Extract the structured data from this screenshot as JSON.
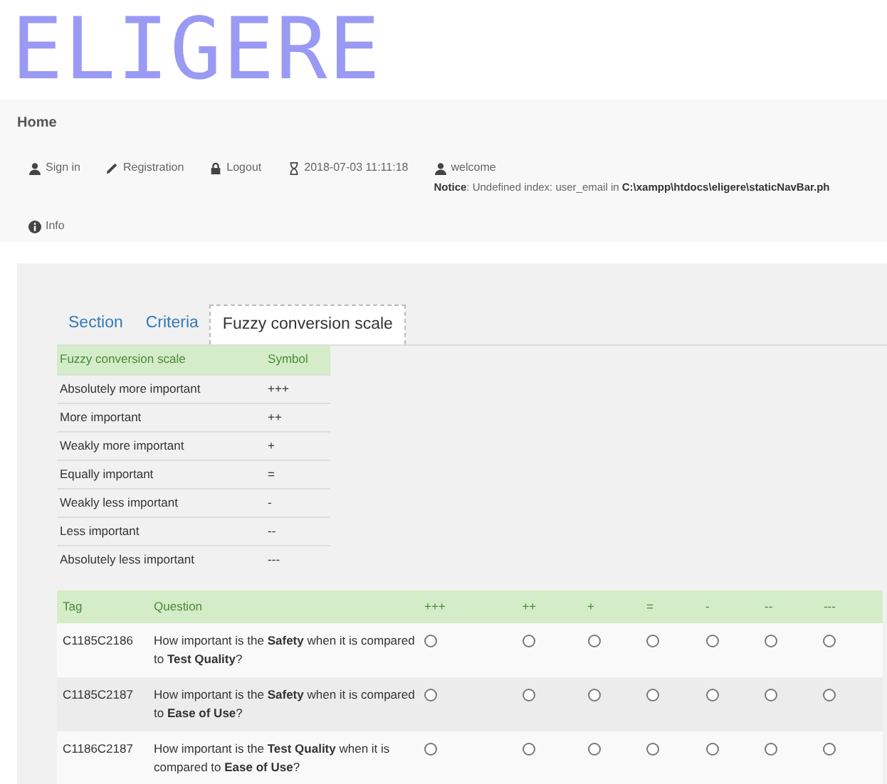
{
  "logo": "ELIGERE",
  "page_title": "Home",
  "nav": [
    {
      "kind": "user",
      "label": "Sign in"
    },
    {
      "kind": "pencil",
      "label": "Registration"
    },
    {
      "kind": "lock",
      "label": "Logout"
    },
    {
      "kind": "hourglass",
      "label": "2018-07-03 11:11:18"
    },
    {
      "kind": "user",
      "label": "welcome"
    }
  ],
  "notice": {
    "label": "Notice",
    "text": ": Undefined index: user_email in ",
    "path": "C:\\xampp\\htdocs\\eligere\\staticNavBar.ph"
  },
  "info": {
    "kind": "info",
    "label": "Info"
  },
  "tabs": [
    {
      "label": "Section",
      "selected": false
    },
    {
      "label": "Criteria",
      "selected": false
    },
    {
      "label": "Fuzzy conversion scale",
      "selected": true
    }
  ],
  "scale_table": {
    "columns": [
      "Fuzzy conversion scale",
      "Symbol"
    ],
    "rows": [
      [
        "Absolutely more important",
        "+++"
      ],
      [
        "More important",
        "++"
      ],
      [
        "Weakly more important",
        "+"
      ],
      [
        "Equally important",
        "="
      ],
      [
        "Weakly less important",
        "-"
      ],
      [
        "Less important",
        "--"
      ],
      [
        "Absolutely less important",
        "---"
      ]
    ]
  },
  "question_table": {
    "columns": [
      "Tag",
      "Question",
      "+++",
      "++",
      "+",
      "=",
      "-",
      "--",
      "---"
    ],
    "rows": [
      {
        "tag": "C1185C2186",
        "question": "How important is the **Safety** when it is compared to **Test Quality**?",
        "options": [
          {
            "selected": false
          },
          {
            "selected": false
          },
          {
            "selected": false
          },
          {
            "selected": false
          },
          {
            "selected": false
          },
          {
            "selected": false
          },
          {
            "selected": false
          }
        ]
      },
      {
        "tag": "C1185C2187",
        "question": "How important is the **Safety** when it is compared to **Ease of Use**?",
        "options": [
          {
            "selected": false
          },
          {
            "selected": false
          },
          {
            "selected": false
          },
          {
            "selected": false
          },
          {
            "selected": false
          },
          {
            "selected": false
          },
          {
            "selected": false
          }
        ]
      },
      {
        "tag": "C1186C2187",
        "question": "How important is the **Test Quality** when it is compared to **Ease of Use**?",
        "options": [
          {
            "selected": false
          },
          {
            "selected": false
          },
          {
            "selected": false
          },
          {
            "selected": false
          },
          {
            "selected": false
          },
          {
            "selected": false
          },
          {
            "selected": false
          }
        ]
      }
    ]
  }
}
